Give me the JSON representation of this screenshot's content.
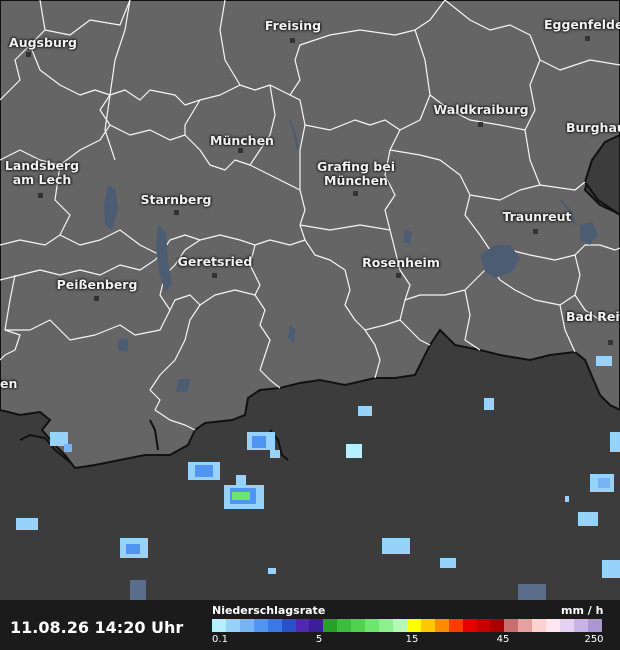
{
  "map": {
    "cities": [
      {
        "id": "augsburg",
        "label": "Augsburg"
      },
      {
        "id": "freising",
        "label": "Freising"
      },
      {
        "id": "eggenfelden",
        "label": "Eggenfelde"
      },
      {
        "id": "waldkraiburg",
        "label": "Waldkraiburg"
      },
      {
        "id": "burghausen",
        "label": "Burghau"
      },
      {
        "id": "muenchen",
        "label": "München"
      },
      {
        "id": "landsberg",
        "label": "Landsberg\nam Lech"
      },
      {
        "id": "grafing",
        "label": "Grafing bei\nMünchen"
      },
      {
        "id": "starnberg",
        "label": "Starnberg"
      },
      {
        "id": "traunreut",
        "label": "Traunreut"
      },
      {
        "id": "geretsried",
        "label": "Geretsried"
      },
      {
        "id": "rosenheim",
        "label": "Rosenheim"
      },
      {
        "id": "peissenberg",
        "label": "Peißenberg"
      },
      {
        "id": "badreichenhall",
        "label": "Bad Reic"
      },
      {
        "id": "edge_en",
        "label": "en"
      }
    ]
  },
  "footer": {
    "timestamp": "11.08.26 14:20 Uhr",
    "legend_title": "Niederschlagsrate",
    "legend_unit": "mm / h",
    "ticks": [
      "0.1",
      "5",
      "15",
      "45",
      "250"
    ],
    "colors": [
      "#b4f0ff",
      "#96d2fa",
      "#78b4f5",
      "#5096f0",
      "#3c78e6",
      "#2850c8",
      "#5028b4",
      "#3c1e9b",
      "#28a028",
      "#3cbe3c",
      "#50d250",
      "#6ee66e",
      "#8cf08c",
      "#b4fab4",
      "#ffff00",
      "#ffc800",
      "#ff8c00",
      "#ff3c00",
      "#e60000",
      "#c80000",
      "#aa0000",
      "#c86e6e",
      "#e6a0a0",
      "#ffd2d2",
      "#ffe6f0",
      "#e6d2f0",
      "#c8b4e6",
      "#aa96d2"
    ]
  }
}
